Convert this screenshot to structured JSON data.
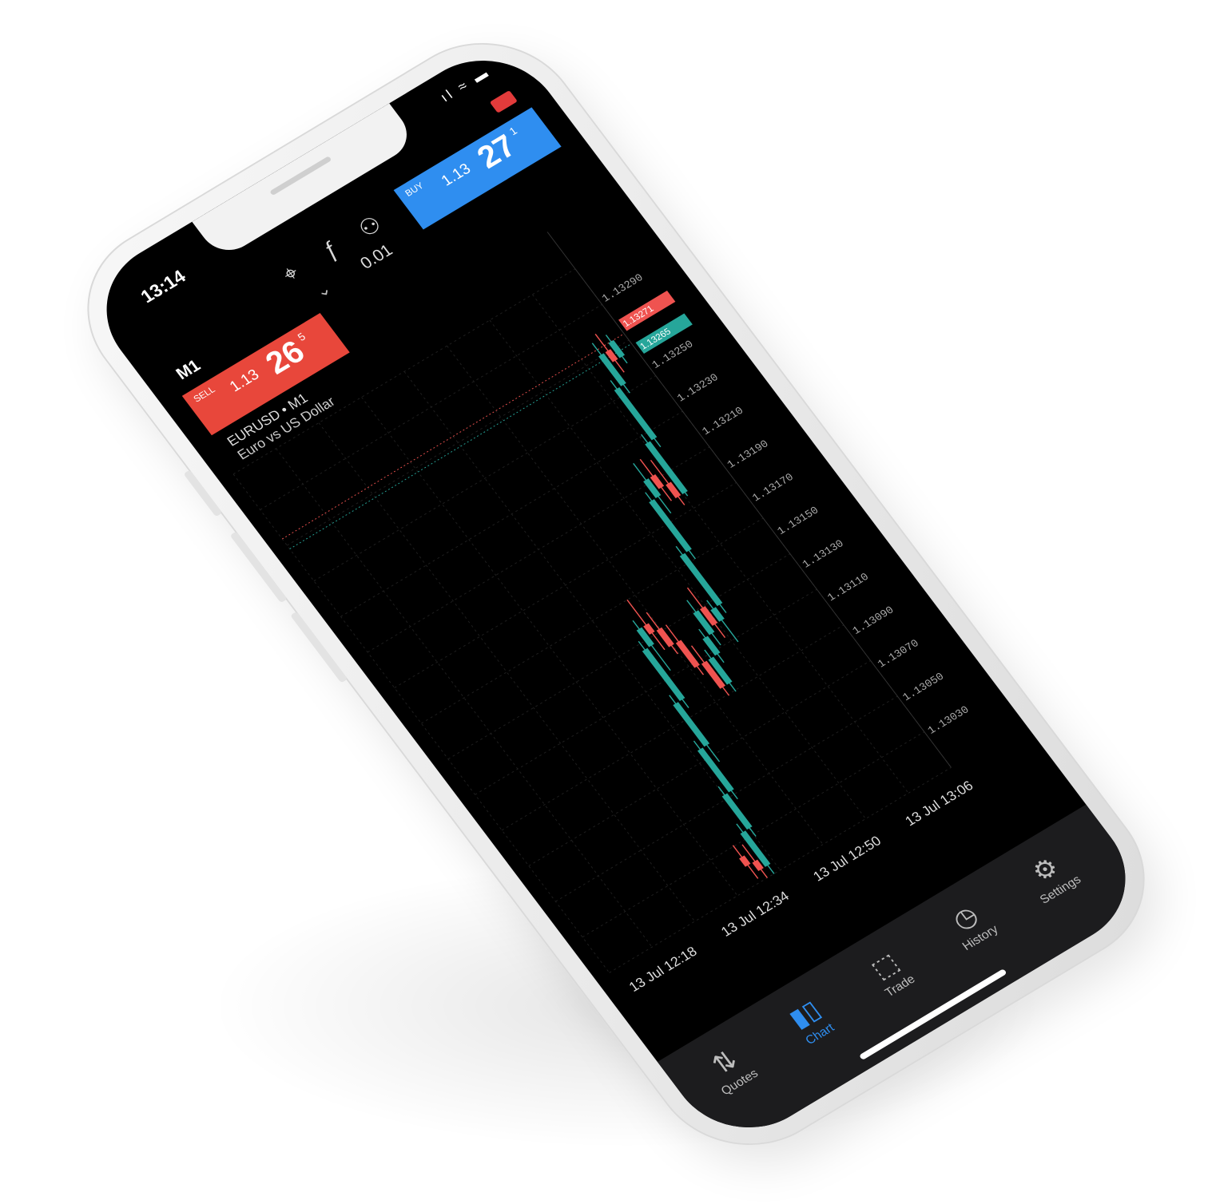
{
  "status_bar": {
    "time": "13:14",
    "icons": "ıl ≈ ▬"
  },
  "toolbar": {
    "crosshair_icon": "crosshair-icon",
    "indicators_icon": "indicators-icon",
    "objects_icon": "objects-icon"
  },
  "chart_header": {
    "timeframe": "M1",
    "lot": "0.01",
    "symbol": "EURUSD • M1",
    "description": "Euro vs US Dollar"
  },
  "sell": {
    "label": "SELL",
    "price_prefix": "1.13",
    "price_big": "26",
    "price_sup": "5",
    "color": "#e8473b"
  },
  "buy": {
    "label": "BUY",
    "price_prefix": "1.13",
    "price_big": "27",
    "price_sup": "1",
    "color": "#2f8ef0"
  },
  "colors": {
    "bull": "#26a69a",
    "bear": "#ef5350",
    "background": "#000000",
    "grid": "#1f1f1f"
  },
  "chart_data": {
    "type": "candlestick",
    "symbol": "EURUSD",
    "timeframe": "M1",
    "price_levels": [
      "1.13290",
      "1.13250",
      "1.13230",
      "1.13210",
      "1.13190",
      "1.13170",
      "1.13150",
      "1.13130",
      "1.13110",
      "1.13090",
      "1.13070",
      "1.13050",
      "1.13030"
    ],
    "ylim": [
      1.1301,
      1.1331
    ],
    "bid_tag": "1.13271",
    "ask_tag": "1.13265",
    "time_labels": [
      "13 Jul 12:18",
      "13 Jul 12:34",
      "13 Jul 12:50",
      "13 Jul 13:06"
    ],
    "candles": [
      {
        "o": 1.13025,
        "h": 1.13032,
        "l": 1.13012,
        "c": 1.1302
      },
      {
        "o": 1.1302,
        "h": 1.1303,
        "l": 1.1301,
        "c": 1.13015
      },
      {
        "o": 1.13015,
        "h": 1.1304,
        "l": 1.1301,
        "c": 1.13035
      },
      {
        "o": 1.13035,
        "h": 1.1306,
        "l": 1.1303,
        "c": 1.13055
      },
      {
        "o": 1.13055,
        "h": 1.13085,
        "l": 1.1305,
        "c": 1.1308
      },
      {
        "o": 1.1308,
        "h": 1.1311,
        "l": 1.1307,
        "c": 1.13105
      },
      {
        "o": 1.13105,
        "h": 1.1314,
        "l": 1.131,
        "c": 1.13135
      },
      {
        "o": 1.13135,
        "h": 1.1315,
        "l": 1.1312,
        "c": 1.13145
      },
      {
        "o": 1.13145,
        "h": 1.1316,
        "l": 1.1313,
        "c": 1.1314
      },
      {
        "o": 1.1314,
        "h": 1.1315,
        "l": 1.13125,
        "c": 1.1313
      },
      {
        "o": 1.1313,
        "h": 1.1314,
        "l": 1.1311,
        "c": 1.13115
      },
      {
        "o": 1.13115,
        "h": 1.13125,
        "l": 1.13095,
        "c": 1.131
      },
      {
        "o": 1.131,
        "h": 1.1312,
        "l": 1.13095,
        "c": 1.13115
      },
      {
        "o": 1.13115,
        "h": 1.1313,
        "l": 1.1311,
        "c": 1.13125
      },
      {
        "o": 1.13125,
        "h": 1.13145,
        "l": 1.13118,
        "c": 1.13138
      },
      {
        "o": 1.13138,
        "h": 1.1315,
        "l": 1.1312,
        "c": 1.13128
      },
      {
        "o": 1.13128,
        "h": 1.1314,
        "l": 1.13115,
        "c": 1.13135
      },
      {
        "o": 1.13135,
        "h": 1.1317,
        "l": 1.1313,
        "c": 1.13165
      },
      {
        "o": 1.13165,
        "h": 1.132,
        "l": 1.1316,
        "c": 1.13195
      },
      {
        "o": 1.13195,
        "h": 1.13215,
        "l": 1.13185,
        "c": 1.13205
      },
      {
        "o": 1.13205,
        "h": 1.13215,
        "l": 1.1319,
        "c": 1.13198
      },
      {
        "o": 1.13198,
        "h": 1.13212,
        "l": 1.13185,
        "c": 1.1319
      },
      {
        "o": 1.1319,
        "h": 1.13225,
        "l": 1.13188,
        "c": 1.1322
      },
      {
        "o": 1.1322,
        "h": 1.13255,
        "l": 1.13215,
        "c": 1.1325
      },
      {
        "o": 1.1325,
        "h": 1.13275,
        "l": 1.13245,
        "c": 1.13268
      },
      {
        "o": 1.13268,
        "h": 1.13278,
        "l": 1.13255,
        "c": 1.13262
      },
      {
        "o": 1.13262,
        "h": 1.13275,
        "l": 1.13258,
        "c": 1.13271
      }
    ]
  },
  "tabs": [
    {
      "label": "Quotes",
      "icon": "quotes-icon",
      "glyph": "⇅"
    },
    {
      "label": "Chart",
      "icon": "chart-icon",
      "glyph": "▮▯"
    },
    {
      "label": "Trade",
      "icon": "trade-icon",
      "glyph": "⬚"
    },
    {
      "label": "History",
      "icon": "history-icon",
      "glyph": "◷"
    },
    {
      "label": "Settings",
      "icon": "settings-icon",
      "glyph": "⚙"
    }
  ],
  "active_tab": "Chart"
}
